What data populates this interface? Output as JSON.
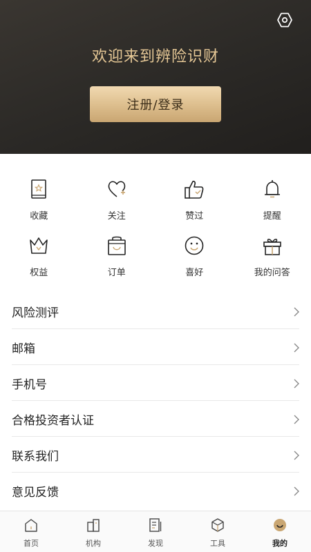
{
  "header": {
    "welcome": "欢迎来到辨险识财",
    "login_label": "注册/登录"
  },
  "colors": {
    "gold_text": "#e6c896",
    "gold_button": "#dcbd8c",
    "header_bg": "#2b2926",
    "icon_accent": "#c9a672"
  },
  "grid": [
    {
      "label": "收藏",
      "icon": "bookmark-icon"
    },
    {
      "label": "关注",
      "icon": "heart-plus-icon"
    },
    {
      "label": "赞过",
      "icon": "thumbs-up-icon"
    },
    {
      "label": "提醒",
      "icon": "bell-icon"
    },
    {
      "label": "权益",
      "icon": "crown-icon"
    },
    {
      "label": "订单",
      "icon": "shopping-bag-icon"
    },
    {
      "label": "喜好",
      "icon": "smiley-icon"
    },
    {
      "label": "我的问答",
      "icon": "gift-icon"
    }
  ],
  "menu": [
    {
      "label": "风险测评"
    },
    {
      "label": "邮箱"
    },
    {
      "label": "手机号"
    },
    {
      "label": "合格投资者认证"
    },
    {
      "label": "联系我们"
    },
    {
      "label": "意见反馈"
    }
  ],
  "tabs": [
    {
      "label": "首页",
      "icon": "home-icon"
    },
    {
      "label": "机构",
      "icon": "building-icon"
    },
    {
      "label": "发现",
      "icon": "document-icon"
    },
    {
      "label": "工具",
      "icon": "cube-icon"
    },
    {
      "label": "我的",
      "icon": "profile-icon",
      "active": true
    }
  ]
}
